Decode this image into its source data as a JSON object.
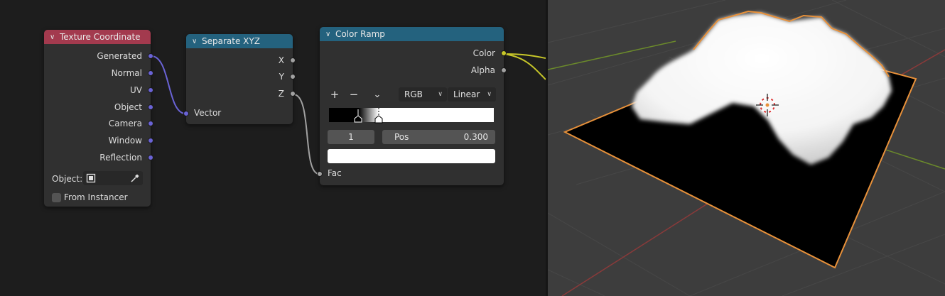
{
  "nodes": {
    "texture_coordinate": {
      "title": "Texture Coordinate",
      "outputs": [
        "Generated",
        "Normal",
        "UV",
        "Object",
        "Camera",
        "Window",
        "Reflection"
      ],
      "object_label": "Object:",
      "from_instancer_label": "From Instancer"
    },
    "separate_xyz": {
      "title": "Separate XYZ",
      "outputs": [
        "X",
        "Y",
        "Z"
      ],
      "input": "Vector"
    },
    "color_ramp": {
      "title": "Color Ramp",
      "outputs": [
        "Color",
        "Alpha"
      ],
      "add_label": "+",
      "remove_label": "−",
      "menu_label": "⌄",
      "color_mode": "RGB",
      "interpolation": "Linear",
      "stop_index": "1",
      "pos_label": "Pos",
      "pos_value": "0.300",
      "input": "Fac",
      "stops": [
        {
          "position": 0.18,
          "color": "#000000"
        },
        {
          "position": 0.3,
          "color": "#ffffff"
        }
      ]
    }
  },
  "colors": {
    "editor_bg": "#1d1d1d",
    "viewport_bg": "#3d3d3d",
    "node_bg": "#303030",
    "header_input": "#a33a4e",
    "header_converter": "#24627e",
    "socket_vector": "#6a63d6",
    "socket_float": "#a1a1a1",
    "socket_color": "#c7c729",
    "selection_outline": "#e8913a"
  },
  "icons": {
    "collapse": "chevron-down-icon",
    "object_picker": "object-icon",
    "eyedropper": "eyedropper-icon"
  }
}
